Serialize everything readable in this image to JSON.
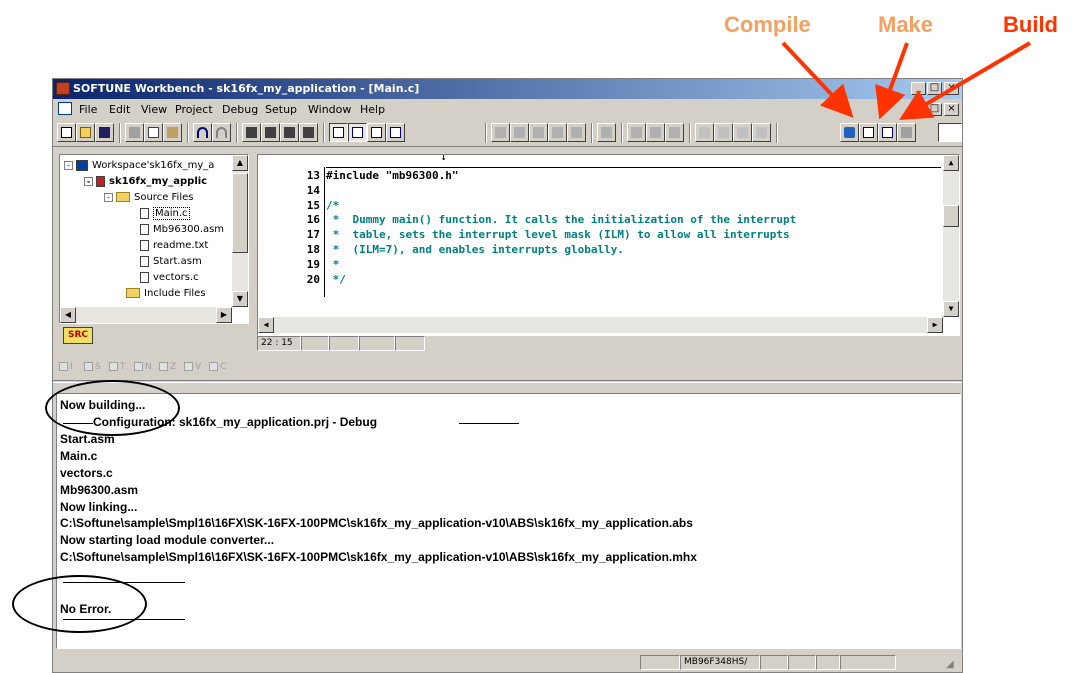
{
  "callouts": {
    "compile": "Compile",
    "make": "Make",
    "build": "Build",
    "compile_color": "#f4a060",
    "make_color": "#f4a060",
    "build_color": "#ff3300",
    "arrow_color": "#ff3300"
  },
  "window": {
    "title": "SOFTUNE Workbench - sk16fx_my_application - [Main.c]",
    "minimize": "_",
    "maximize": "□",
    "close": "×"
  },
  "menu": [
    "File",
    "Edit",
    "View",
    "Project",
    "Debug",
    "Setup",
    "Window",
    "Help"
  ],
  "tree": {
    "workspace": "Workspace'sk16fx_my_a",
    "project": "sk16fx_my_applic",
    "source_folder": "Source Files",
    "files": [
      "Main.c",
      "Mb96300.asm",
      "readme.txt",
      "Start.asm",
      "vectors.c"
    ],
    "include_folder": "Include Files",
    "tab_label": "SRC"
  },
  "editor": {
    "lines": [
      {
        "num": "13",
        "text": "#include \"mb96300.h\"",
        "kind": "include"
      },
      {
        "num": "14",
        "text": "",
        "kind": "blank"
      },
      {
        "num": "15",
        "text": "/*",
        "kind": "comment"
      },
      {
        "num": "16",
        "text": " *  Dummy main() function. It calls the initialization of the interrupt",
        "kind": "comment"
      },
      {
        "num": "17",
        "text": " *  table, sets the interrupt level mask (ILM) to allow all interrupts",
        "kind": "comment"
      },
      {
        "num": "18",
        "text": " *  (ILM=7), and enables interrupts globally.",
        "kind": "comment"
      },
      {
        "num": "19",
        "text": " *",
        "kind": "comment"
      },
      {
        "num": "20",
        "text": " */",
        "kind": "comment"
      }
    ],
    "cursor_pos": "22 : 15",
    "comment_color": "#008080"
  },
  "flags": [
    "I",
    "S",
    "T",
    "N",
    "Z",
    "V",
    "C"
  ],
  "output": {
    "lines": [
      "Now building...",
      "Configuration: sk16fx_my_application.prj - Debug",
      "Start.asm",
      "Main.c",
      "vectors.c",
      "Mb96300.asm",
      "Now linking...",
      "C:\\Softune\\sample\\Smpl16\\16FX\\SK-16FX-100PMC\\sk16fx_my_application-v10\\ABS\\sk16fx_my_application.abs",
      "Now starting load module converter...",
      "C:\\Softune\\sample\\Smpl16\\16FX\\SK-16FX-100PMC\\sk16fx_my_application-v10\\ABS\\sk16fx_my_application.mhx",
      "No Error."
    ]
  },
  "statusbar": {
    "chip": "MB96F348HS/"
  }
}
